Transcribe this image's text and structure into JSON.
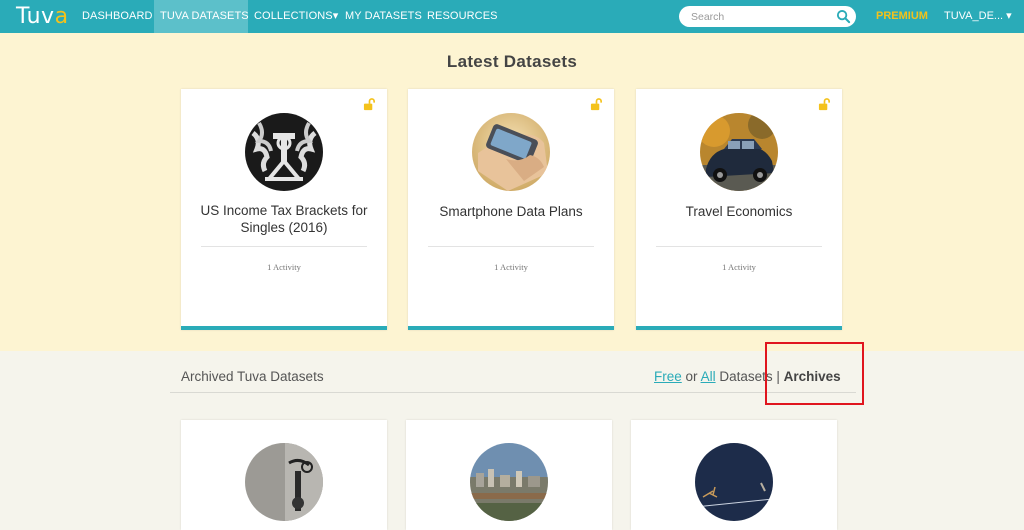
{
  "nav": {
    "logo_main": "Tuv",
    "logo_accent": "a",
    "items": [
      {
        "label": "DASHBOARD"
      },
      {
        "label": "TUVA DATASETS"
      },
      {
        "label": "COLLECTIONS▾"
      },
      {
        "label": "MY DATASETS"
      },
      {
        "label": "RESOURCES"
      }
    ],
    "search_placeholder": "Search",
    "premium": "PREMIUM",
    "user": "TUVA_DE... ▾"
  },
  "latest": {
    "title": "Latest Datasets",
    "cards": [
      {
        "title": "US Income Tax Brackets for Singles (2016)",
        "meta": "1 Activity"
      },
      {
        "title": "Smartphone Data Plans",
        "meta": "1 Activity"
      },
      {
        "title": "Travel Economics",
        "meta": "1 Activity"
      }
    ]
  },
  "archived": {
    "title": "Archived Tuva Datasets",
    "filter": {
      "free": "Free",
      "or": "or",
      "all": "All",
      "datasets": "Datasets |",
      "archives": "Archives"
    }
  },
  "colors": {
    "accent": "#2aabb8",
    "premium": "#f4c21b",
    "latest_bg": "#fdf4d2",
    "highlight": "#e0151e"
  }
}
